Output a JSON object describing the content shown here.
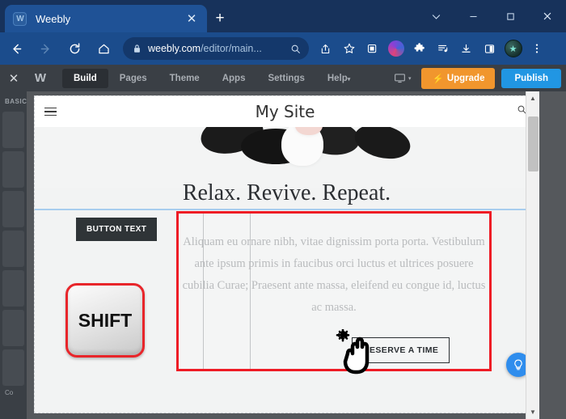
{
  "browser": {
    "tab": {
      "title": "Weebly",
      "favicon": "weebly-w-icon",
      "close": "✕"
    },
    "new_tab": "+",
    "window_controls": {
      "tab_search": "tab-search-icon",
      "minimize": "—",
      "maximize": "□",
      "close": "✕"
    },
    "nav": {
      "back": "←",
      "forward": "→",
      "reload": "↻",
      "home": "⌂",
      "lock": "lock-icon",
      "url_domain": "weebly.com",
      "url_path": "/editor/main...",
      "omni_search": "search-icon"
    },
    "toolbar_icons": [
      "share-icon",
      "bookmark-star-icon",
      "screenshot-icon",
      "profile-color-icon",
      "extensions-puzzle-icon",
      "media-list-icon",
      "download-icon",
      "side-panel-icon",
      "avatar-icon",
      "browser-menu-icon"
    ]
  },
  "editor_nav": {
    "close_label": "✕",
    "logo": "weebly-logo",
    "items": [
      {
        "label": "Build",
        "active": true
      },
      {
        "label": "Pages",
        "active": false
      },
      {
        "label": "Theme",
        "active": false
      },
      {
        "label": "Apps",
        "active": false
      },
      {
        "label": "Settings",
        "active": false
      },
      {
        "label": "Help",
        "active": false,
        "caret": "▾"
      }
    ],
    "device_caret": "▾",
    "upgrade_label": "Upgrade",
    "upgrade_bolt": "⚡",
    "upgrade_color": "#f1962d",
    "publish_label": "Publish",
    "publish_color": "#2196e3"
  },
  "sidebar": {
    "section_label": "BASIC",
    "footer_label": "Co"
  },
  "site": {
    "menu_icon": "hamburger-menu-icon",
    "title": "My Site",
    "search_icon": "search-icon",
    "tagline": "Relax. Revive. Repeat.",
    "button_text": "BUTTON TEXT",
    "paragraph": "Aliquam eu ornare nibh, vitae dignissim porta porta. Vestibulum ante ipsum primis in faucibus orci luctus et ultrices posuere cubilia Curae; Praesent ante massa, eleifend eu congue id, luctus ac massa.",
    "reserve_button": "RESERVE A TIME",
    "selection_border_color": "#ee1c25",
    "guide_color": "#a8cdee"
  },
  "annotation": {
    "key_label": "SHIFT",
    "key_outline_color": "#e8252a",
    "cursor": "grabbing-hand-move-cursor"
  },
  "help": {
    "icon": "lightbulb-icon",
    "color": "#2f8ded"
  },
  "scrollbar": {
    "up": "▲",
    "down": "▼"
  }
}
